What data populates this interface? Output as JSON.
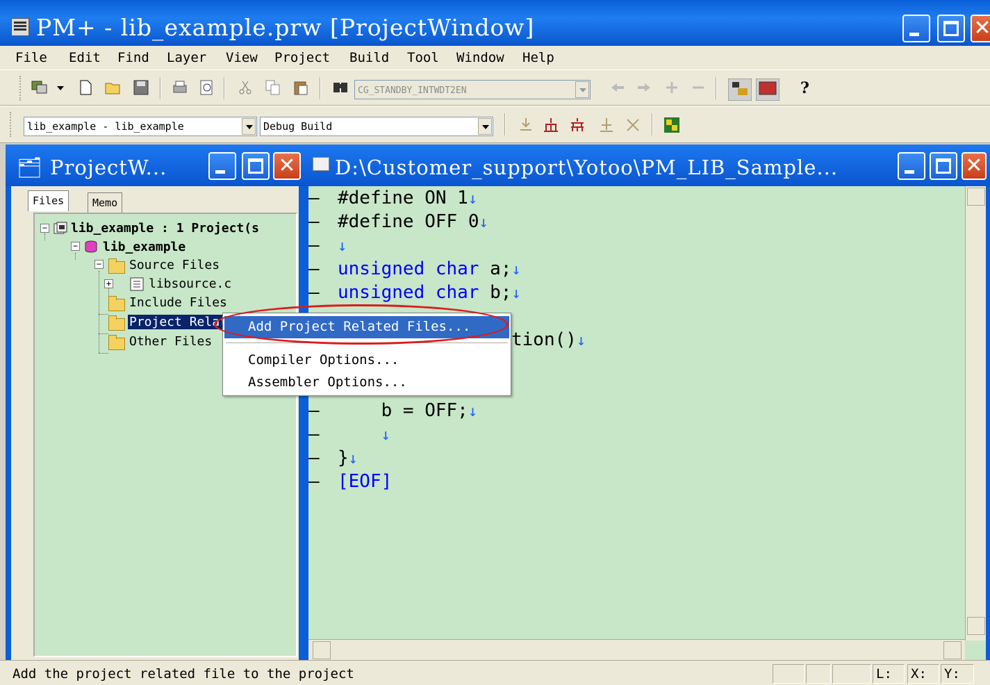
{
  "window": {
    "title": "PM+ - lib_example.prw [ProjectWindow]"
  },
  "menu": [
    "File",
    "Edit",
    "Find",
    "Layer",
    "View",
    "Project",
    "Build",
    "Tool",
    "Window",
    "Help"
  ],
  "toolbar": {
    "function_combo": "CG_STANDBY_INTWDT2EN",
    "project_combo": "lib_example - lib_example",
    "build_combo": "Debug Build"
  },
  "project_window": {
    "title": "ProjectW...",
    "tabs": [
      "Files",
      "Memo"
    ],
    "tree": {
      "root": "lib_example : 1 Project(s",
      "project": "lib_example",
      "source_files": "Source Files",
      "libsource": "libsource.c",
      "include_files": "Include Files",
      "project_related": "Project Relat",
      "other_files": "Other Files"
    }
  },
  "editor": {
    "title": "D:\\Customer_support\\Yotoo\\PM_LIB_Sample...",
    "lines": [
      {
        "pre": "#define ON 1",
        "kw": "",
        "post": ""
      },
      {
        "pre": "#define OFF 0",
        "kw": "",
        "post": ""
      },
      {
        "pre": "",
        "kw": "",
        "post": ""
      },
      {
        "pre": "",
        "kw": "unsigned char",
        "post": " a;"
      },
      {
        "pre": "",
        "kw": "unsigned char",
        "post": " b;"
      },
      {
        "pre": "",
        "kw": "",
        "post": "tion()"
      },
      {
        "pre": "    b = OFF;",
        "kw": "",
        "post": ""
      },
      {
        "pre": "    ",
        "kw": "",
        "post": ""
      },
      {
        "pre": "}",
        "kw": "",
        "post": ""
      }
    ],
    "eof": "[EOF]"
  },
  "context_menu": {
    "items": [
      "Add Project Related Files...",
      "Compiler Options...",
      "Assembler Options..."
    ]
  },
  "status": {
    "text": "Add the project related file to the project",
    "l_label": "L:",
    "x_label": "X:",
    "y_label": "Y:"
  }
}
